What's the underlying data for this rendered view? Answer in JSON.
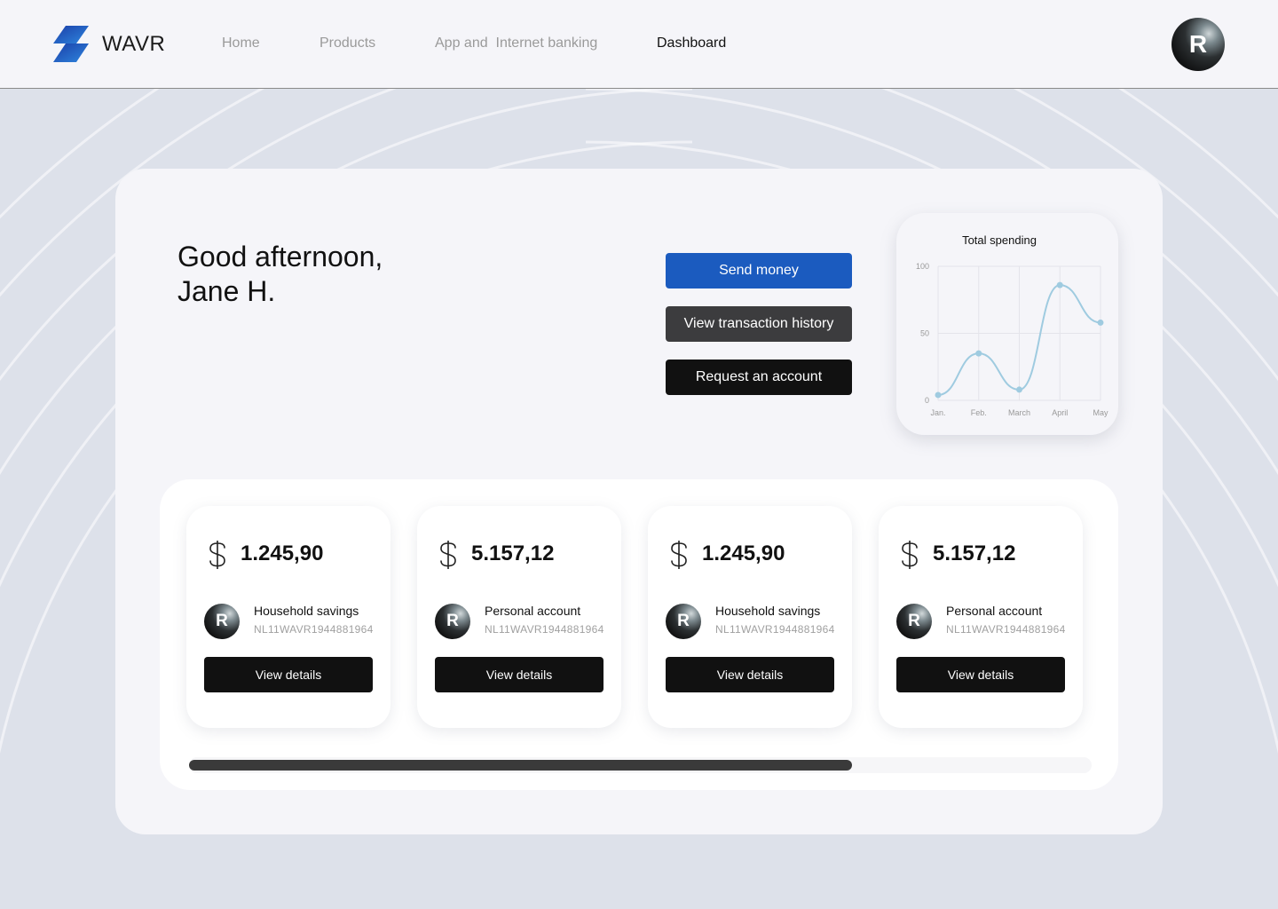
{
  "brand": {
    "name": "WAVR",
    "logo_colors": [
      "#1b5bbf",
      "#2e86de"
    ]
  },
  "nav": {
    "items": [
      {
        "label": "Home",
        "active": false
      },
      {
        "label": "Products",
        "active": false
      },
      {
        "label": "App and  Internet banking",
        "active": false
      },
      {
        "label": "Dashboard",
        "active": true
      }
    ]
  },
  "user": {
    "avatar_initial": "R"
  },
  "greeting": {
    "line1": "Good afternoon,",
    "line2": "Jane H."
  },
  "actions": {
    "send_money": "Send money",
    "view_history": "View transaction history",
    "request_account": "Request an account"
  },
  "chart_data": {
    "type": "line",
    "title": "Total spending",
    "categories": [
      "Jan.",
      "Feb.",
      "March",
      "April",
      "May"
    ],
    "series": [
      {
        "values": [
          4,
          35,
          8,
          86,
          58
        ]
      }
    ],
    "ylim": [
      0,
      100
    ],
    "yticks": [
      0,
      50,
      100
    ],
    "grid": true,
    "line_color": "#9fcbe0"
  },
  "accounts": [
    {
      "currency_icon": "dollar-icon",
      "amount": "1.245,90",
      "avatar_initial": "R",
      "name": "Household savings",
      "iban": "NL11WAVR1944881964",
      "button": "View details"
    },
    {
      "currency_icon": "dollar-icon",
      "amount": "5.157,12",
      "avatar_initial": "R",
      "name": "Personal account",
      "iban": "NL11WAVR1944881964",
      "button": "View details"
    },
    {
      "currency_icon": "dollar-icon",
      "amount": "1.245,90",
      "avatar_initial": "R",
      "name": "Household savings",
      "iban": "NL11WAVR1944881964",
      "button": "View details"
    },
    {
      "currency_icon": "dollar-icon",
      "amount": "5.157,12",
      "avatar_initial": "R",
      "name": "Personal account",
      "iban": "NL11WAVR1944881964",
      "button": "View details"
    }
  ],
  "scroll": {
    "visible_fraction": 0.735,
    "position": 0
  }
}
